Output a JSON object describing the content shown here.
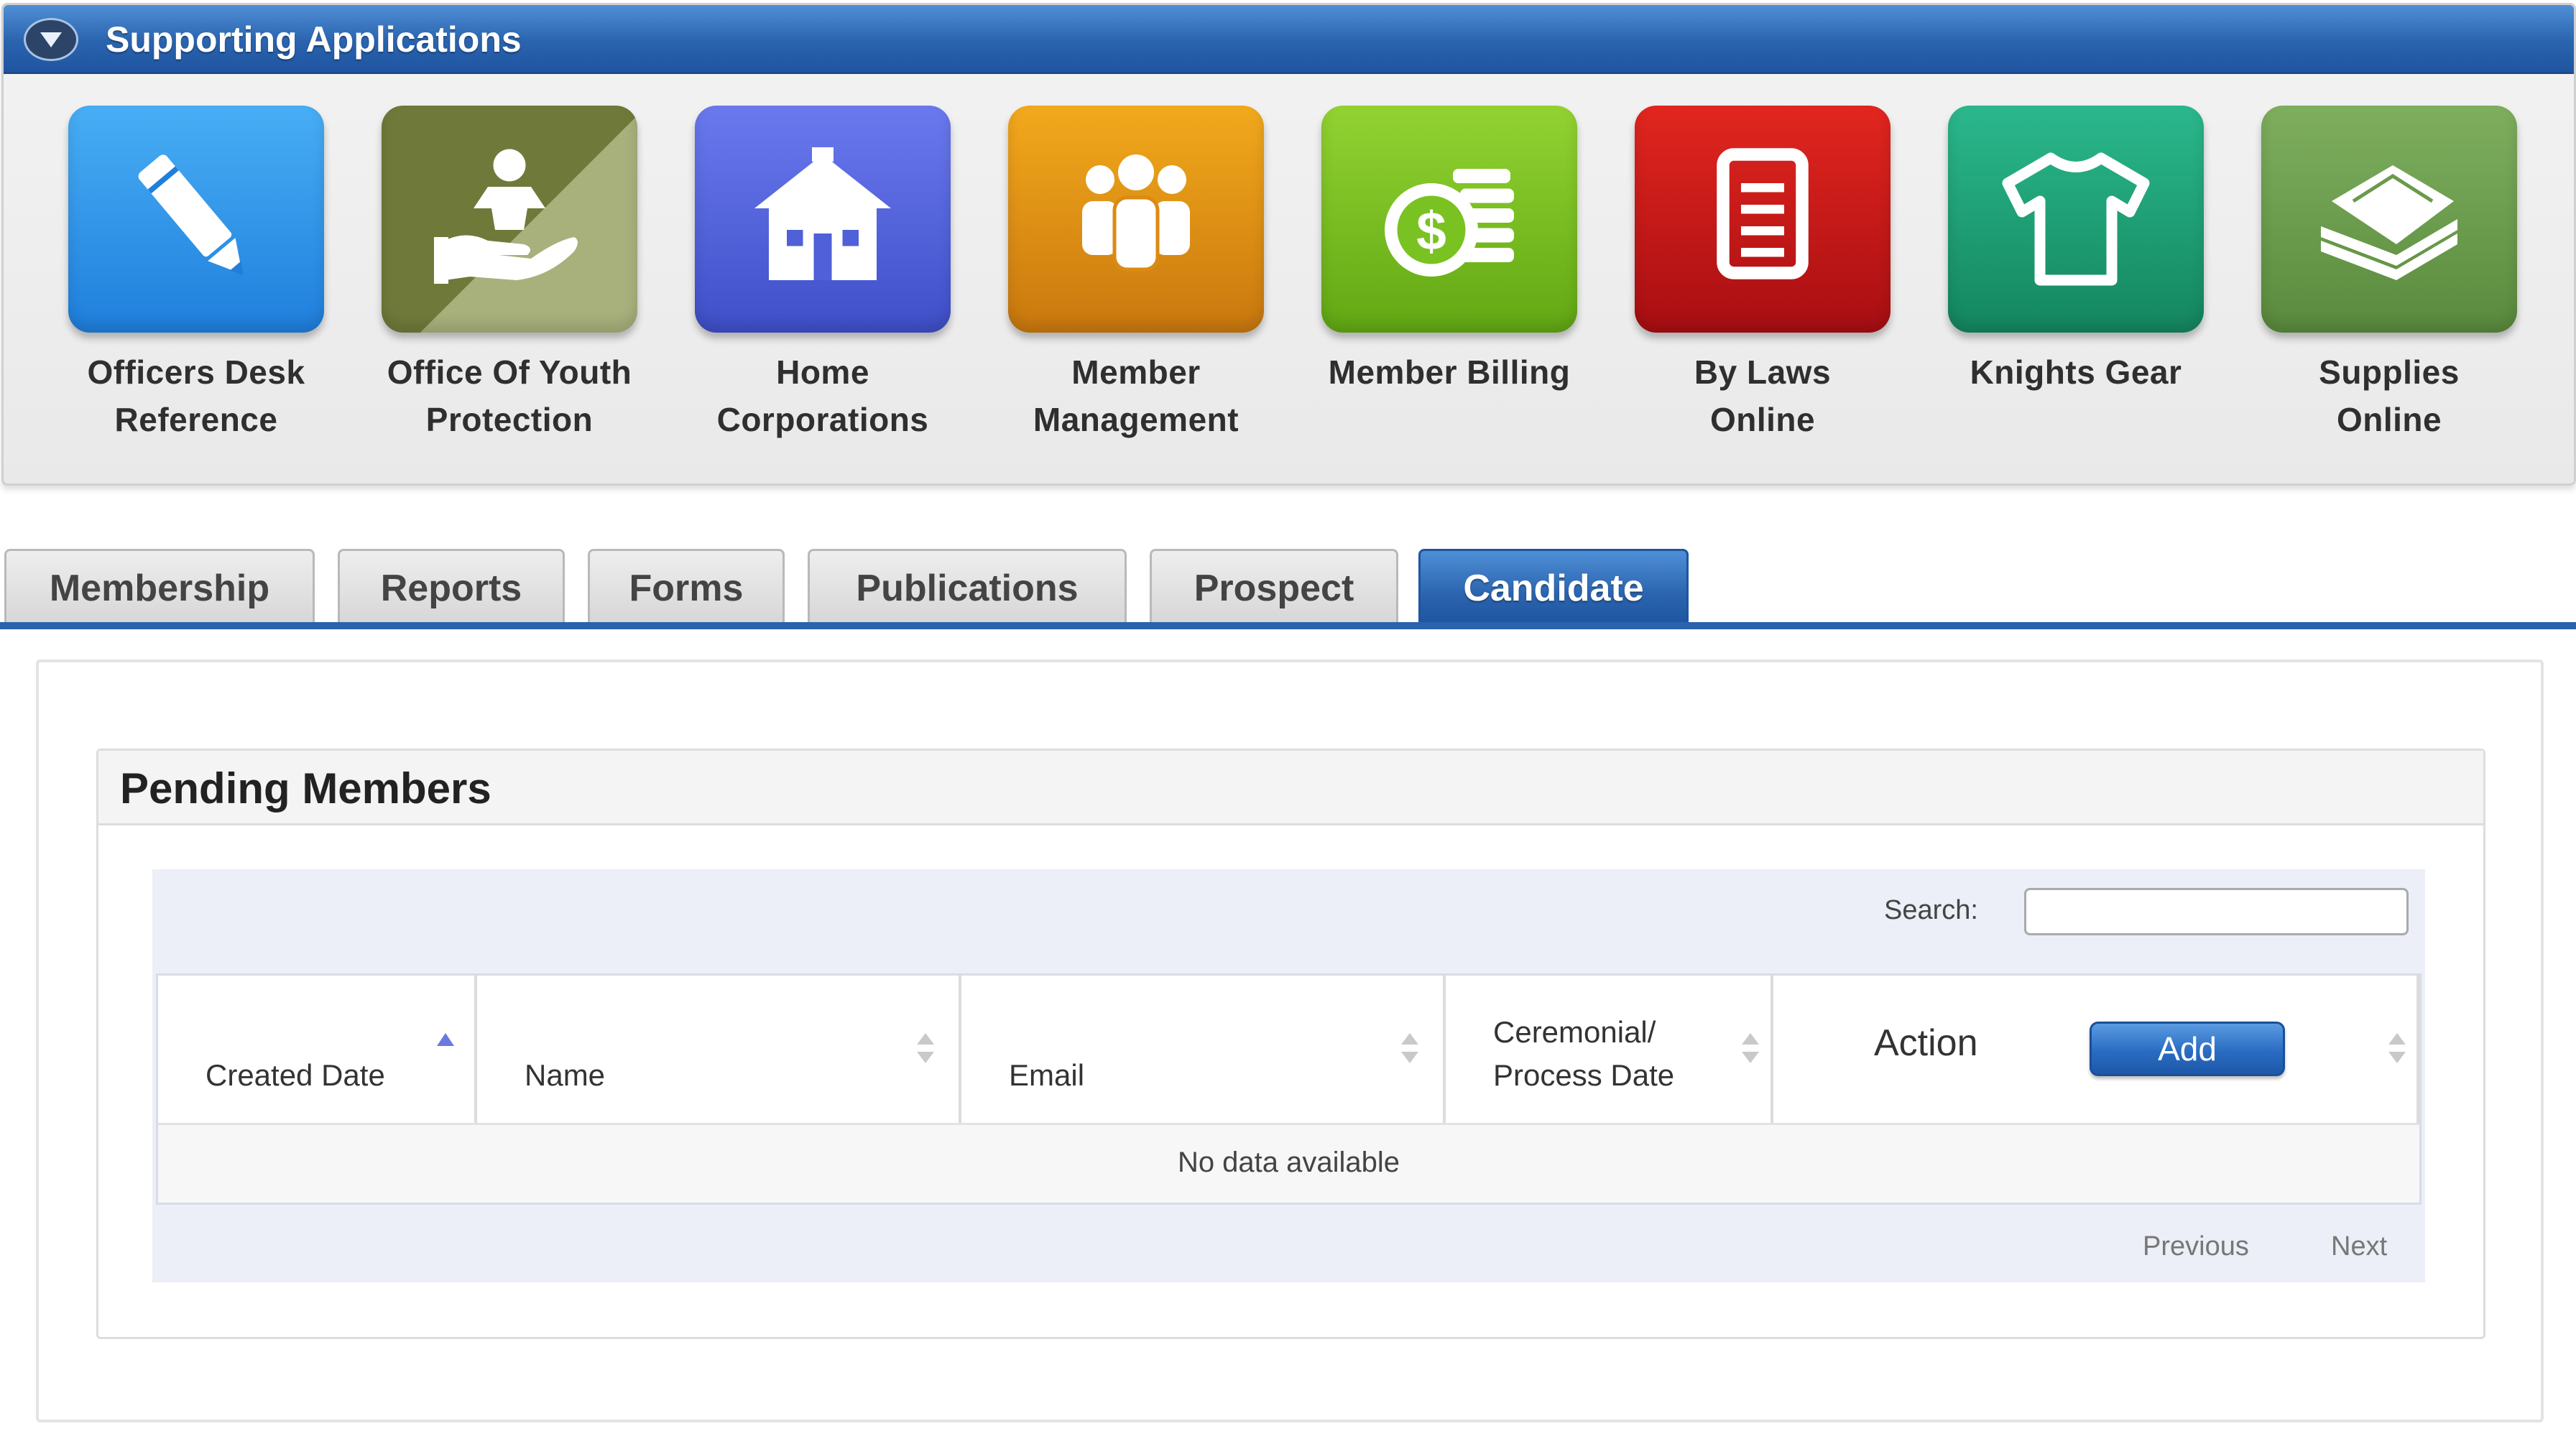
{
  "supporting_apps": {
    "title": "Supporting Applications",
    "apps": [
      {
        "label": "Officers Desk\nReference",
        "icon": "pencil-icon",
        "color": "#2f8ee8"
      },
      {
        "label": "Office Of Youth\nProtection",
        "icon": "youth-protection-hand-icon",
        "color": "#6f7a3a"
      },
      {
        "label": "Home\nCorporations",
        "icon": "house-icon",
        "color": "#4f60d8"
      },
      {
        "label": "Member\nManagement",
        "icon": "people-group-icon",
        "color": "#dc8a12"
      },
      {
        "label": "Member Billing",
        "icon": "dollar-coins-icon",
        "color": "#7ac221"
      },
      {
        "label": "By Laws\nOnline",
        "icon": "document-icon",
        "color": "#c7141a"
      },
      {
        "label": "Knights Gear",
        "icon": "t-shirt-icon",
        "color": "#1e9e76"
      },
      {
        "label": "Supplies\nOnline",
        "icon": "paper-stack-icon",
        "color": "#6b9a4c"
      }
    ]
  },
  "tabs": [
    {
      "label": "Membership",
      "active": false
    },
    {
      "label": "Reports",
      "active": false
    },
    {
      "label": "Forms",
      "active": false
    },
    {
      "label": "Publications",
      "active": false
    },
    {
      "label": "Prospect",
      "active": false
    },
    {
      "label": "Candidate",
      "active": true
    }
  ],
  "pending_members": {
    "title": "Pending Members",
    "search_label": "Search:",
    "search_value": "",
    "columns": [
      {
        "label": "Created Date",
        "sort": "ascending"
      },
      {
        "label": "Name",
        "sort": "none"
      },
      {
        "label": "Email",
        "sort": "none"
      },
      {
        "label": "Ceremonial/\nProcess Date",
        "sort": "none"
      },
      {
        "label": "Action",
        "sort": "none"
      }
    ],
    "add_button": "Add",
    "empty_message": "No data available",
    "pager": {
      "previous": "Previous",
      "next": "Next"
    }
  },
  "colors": {
    "header_blue": "#2a63ae",
    "active_tab_blue": "#2a63ae",
    "sort_active": "#6a78e0",
    "sort_inactive": "#c9c9c9"
  }
}
